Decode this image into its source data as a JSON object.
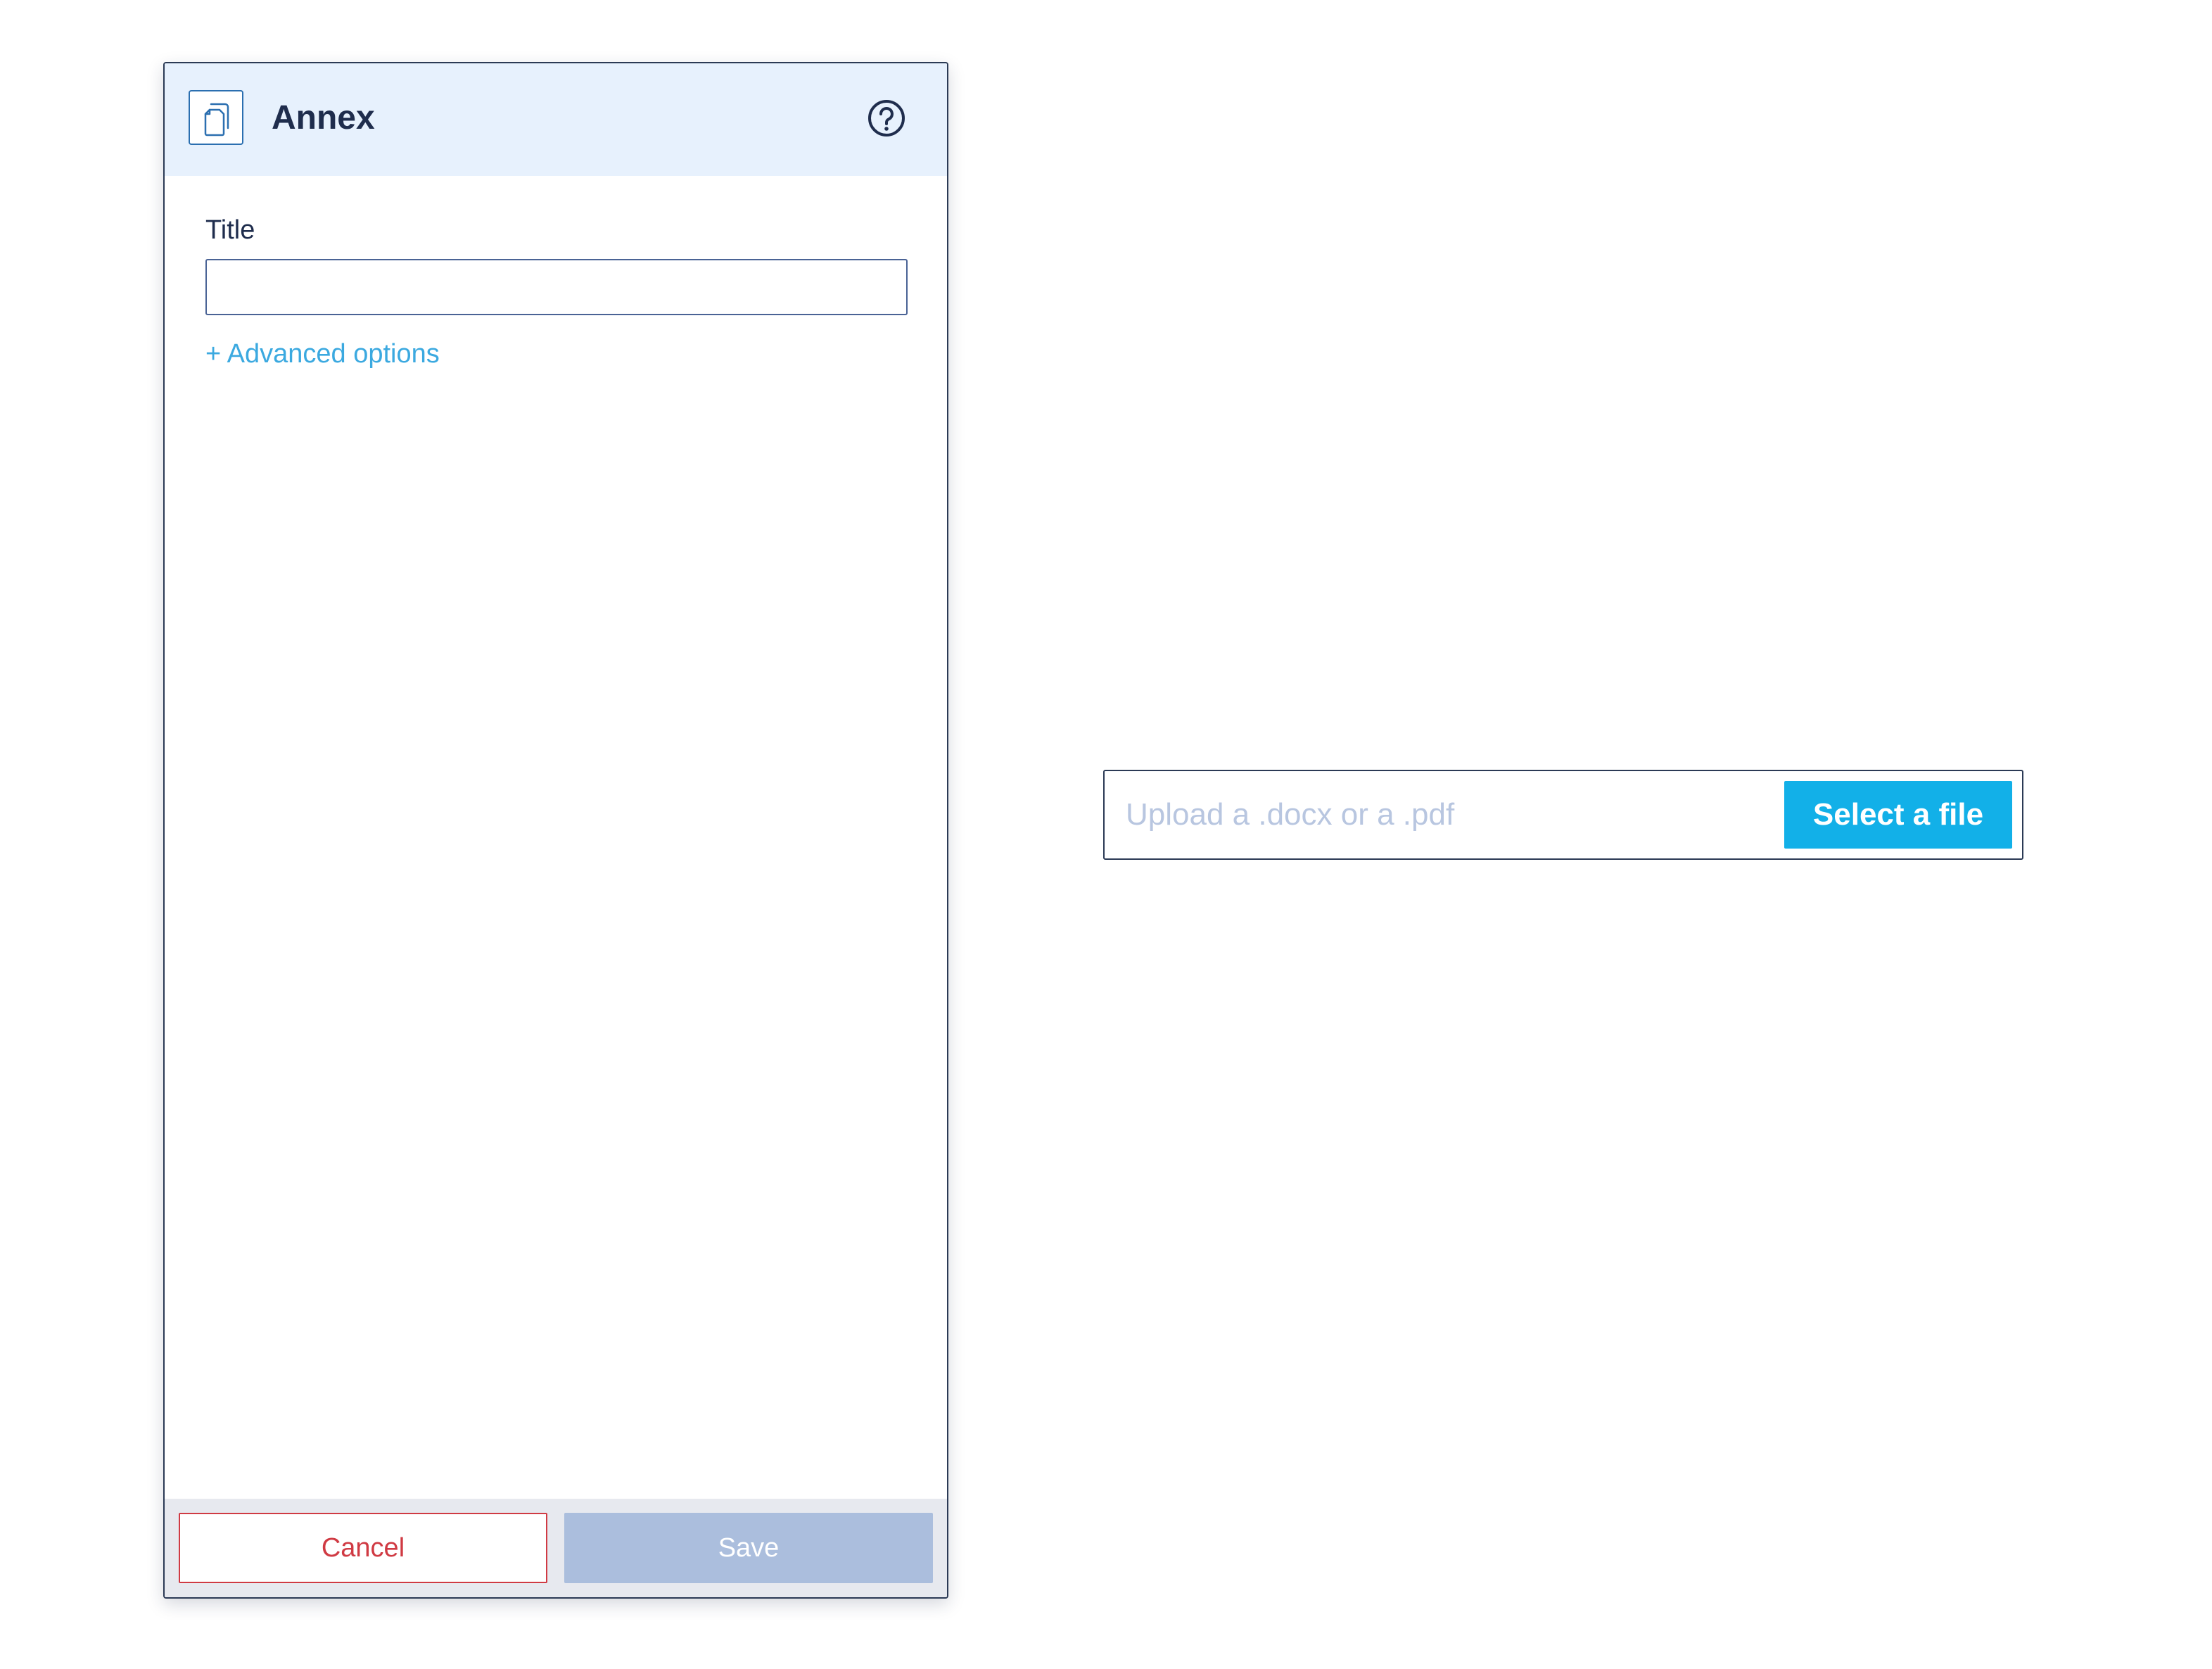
{
  "panel": {
    "title": "Annex",
    "icon": "document-copy-icon",
    "help_icon": "help-circle-icon",
    "form": {
      "title_label": "Title",
      "title_value": "",
      "title_placeholder": "",
      "advanced_options_link": "+ Advanced options"
    },
    "footer": {
      "cancel_label": "Cancel",
      "save_label": "Save"
    }
  },
  "upload": {
    "placeholder": "Upload a .docx or a .pdf",
    "select_button_label": "Select a file"
  },
  "colors": {
    "header_bg": "#e7f1fd",
    "accent_blue": "#12b0e8",
    "link_blue": "#3ba9e0",
    "cancel_red": "#d03a43",
    "save_disabled": "#abbedd",
    "text_dark": "#1f2d4d"
  }
}
